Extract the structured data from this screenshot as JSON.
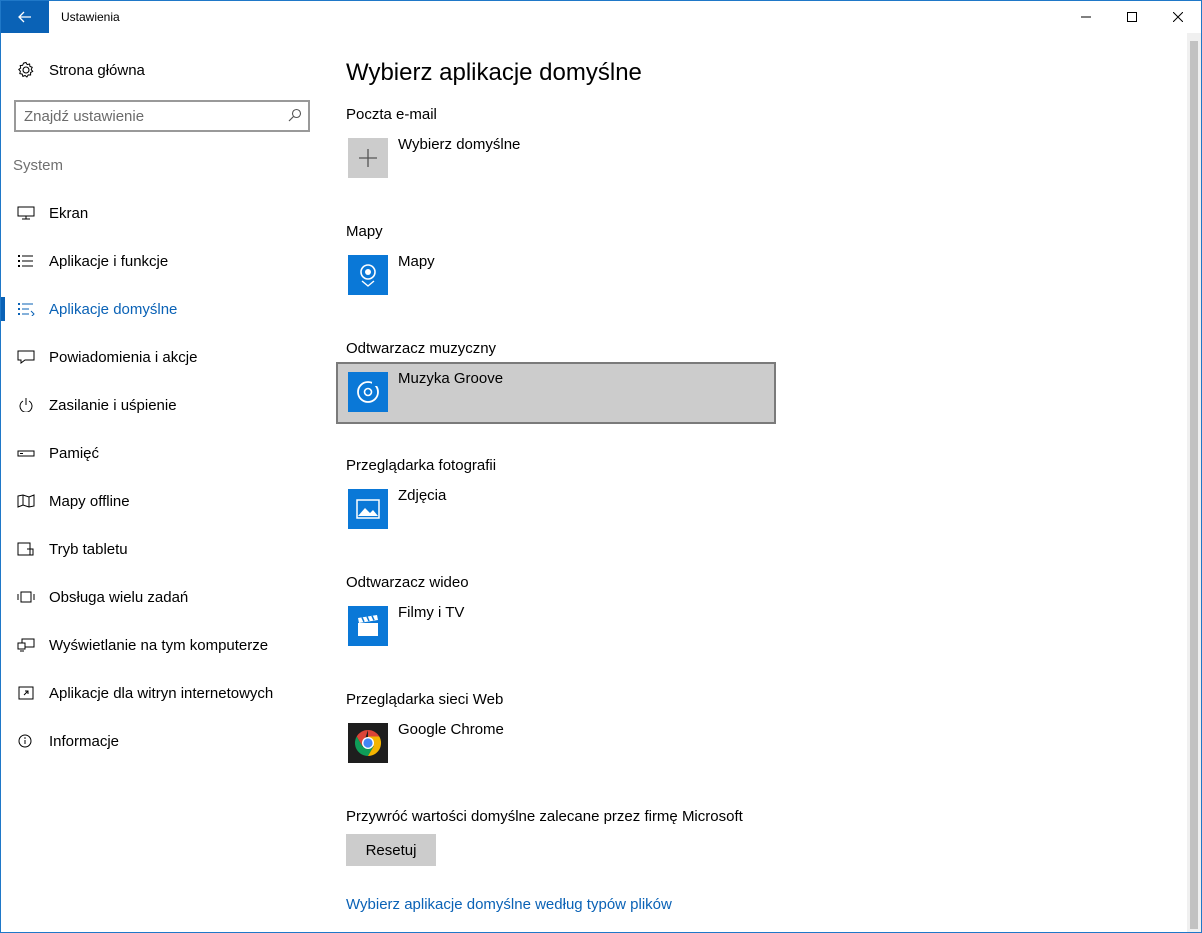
{
  "window": {
    "title": "Ustawienia",
    "accent_color": "#0a62b6"
  },
  "sidebar": {
    "home_label": "Strona główna",
    "search": {
      "placeholder": "Znajdź ustawienie"
    },
    "section_label": "System",
    "items": [
      {
        "label": "Ekran",
        "icon": "monitor-icon",
        "active": false
      },
      {
        "label": "Aplikacje i funkcje",
        "icon": "apps-list-icon",
        "active": false
      },
      {
        "label": "Aplikacje domyślne",
        "icon": "default-apps-icon",
        "active": true
      },
      {
        "label": "Powiadomienia i akcje",
        "icon": "notification-icon",
        "active": false
      },
      {
        "label": "Zasilanie i uśpienie",
        "icon": "power-icon",
        "active": false
      },
      {
        "label": "Pamięć",
        "icon": "storage-icon",
        "active": false
      },
      {
        "label": "Mapy offline",
        "icon": "offline-maps-icon",
        "active": false
      },
      {
        "label": "Tryb tabletu",
        "icon": "tablet-mode-icon",
        "active": false
      },
      {
        "label": "Obsługa wielu zadań",
        "icon": "multitasking-icon",
        "active": false
      },
      {
        "label": "Wyświetlanie na tym komputerze",
        "icon": "projecting-icon",
        "active": false
      },
      {
        "label": "Aplikacje dla witryn internetowych",
        "icon": "apps-for-websites-icon",
        "active": false
      },
      {
        "label": "Informacje",
        "icon": "info-icon",
        "active": false
      }
    ]
  },
  "main": {
    "title": "Wybierz aplikacje domyślne",
    "groups": [
      {
        "label": "Poczta e-mail",
        "app": "Wybierz domyślne",
        "icon": "plus-icon",
        "icon_bg": "#cccccc",
        "selected": false
      },
      {
        "label": "Mapy",
        "app": "Mapy",
        "icon": "maps-app-icon",
        "icon_bg": "#0a78d7",
        "selected": false
      },
      {
        "label": "Odtwarzacz muzyczny",
        "app": "Muzyka Groove",
        "icon": "groove-music-icon",
        "icon_bg": "#0a78d7",
        "selected": true
      },
      {
        "label": "Przeglądarka fotografii",
        "app": "Zdjęcia",
        "icon": "photos-app-icon",
        "icon_bg": "#0a78d7",
        "selected": false
      },
      {
        "label": "Odtwarzacz wideo",
        "app": "Filmy i TV",
        "icon": "movies-tv-icon",
        "icon_bg": "#0a78d7",
        "selected": false
      },
      {
        "label": "Przeglądarka sieci Web",
        "app": "Google Chrome",
        "icon": "chrome-icon",
        "icon_bg": "#1e1e1e",
        "selected": false
      }
    ],
    "reset": {
      "label": "Przywróć wartości domyślne zalecane przez firmę Microsoft",
      "button": "Resetuj"
    },
    "filetype_link": "Wybierz aplikacje domyślne według typów plików"
  }
}
